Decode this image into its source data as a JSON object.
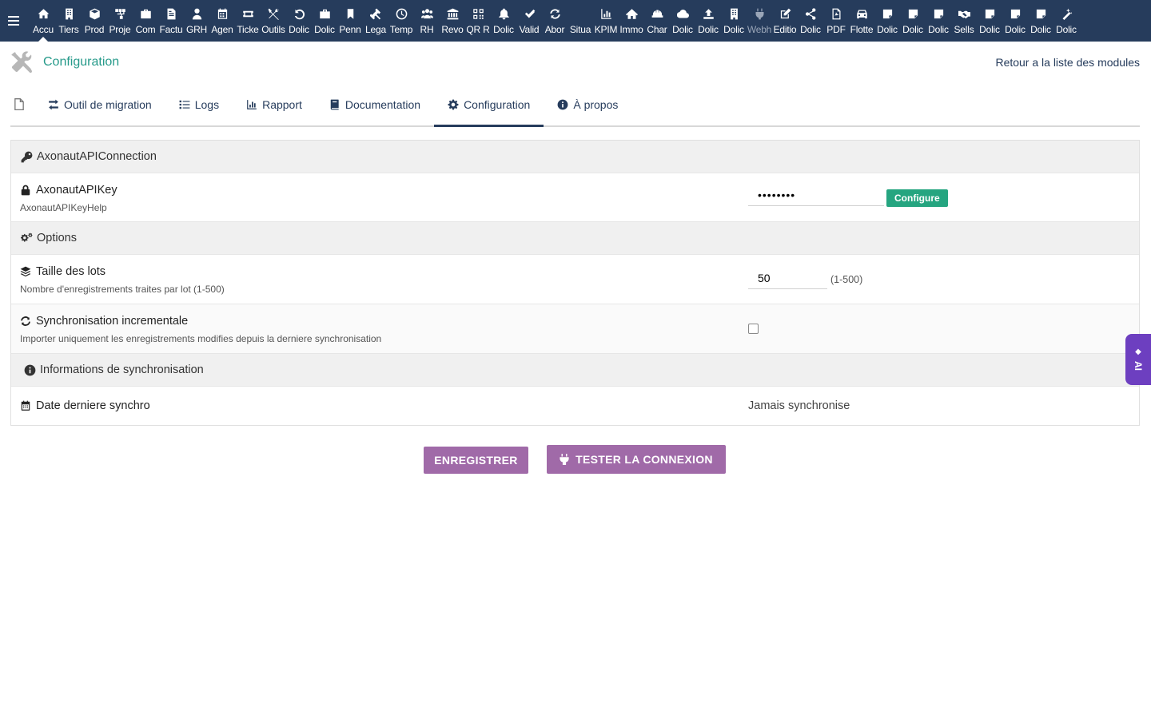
{
  "topbar": {
    "menu": [
      {
        "label": "Accu",
        "icon": "home-icon",
        "active": true
      },
      {
        "label": "Tiers",
        "icon": "building-icon"
      },
      {
        "label": "Prod",
        "icon": "cube-icon"
      },
      {
        "label": "Proje",
        "icon": "sitemap-icon"
      },
      {
        "label": "Com",
        "icon": "briefcase-icon"
      },
      {
        "label": "Factu",
        "icon": "file-invoice-icon"
      },
      {
        "label": "GRH",
        "icon": "user-tie-icon"
      },
      {
        "label": "Agen",
        "icon": "calendar-icon"
      },
      {
        "label": "Ticke",
        "icon": "ticket-icon"
      },
      {
        "label": "Outils",
        "icon": "tools-icon"
      },
      {
        "label": "Dolic",
        "icon": "undo-icon"
      },
      {
        "label": "Dolic",
        "icon": "toolbox-icon"
      },
      {
        "label": "Penn",
        "icon": "bookmark-icon"
      },
      {
        "label": "Lega",
        "icon": "gavel-icon"
      },
      {
        "label": "Temp",
        "icon": "clock-icon"
      },
      {
        "label": "RH",
        "icon": "users-icon"
      },
      {
        "label": "Revo",
        "icon": "bank-icon"
      },
      {
        "label": "QR R",
        "icon": "qrcode-icon"
      },
      {
        "label": "Dolic",
        "icon": "bell-icon"
      },
      {
        "label": "Valid",
        "icon": "double-check-icon"
      },
      {
        "label": "Abor",
        "icon": "sync-icon"
      },
      {
        "label": "Situa",
        "icon": "blank-icon"
      },
      {
        "label": "KPIM",
        "icon": "chart-bar-icon"
      },
      {
        "label": "Immo",
        "icon": "house-icon"
      },
      {
        "label": "Char",
        "icon": "hard-hat-icon"
      },
      {
        "label": "Dolic",
        "icon": "cloud-icon"
      },
      {
        "label": "Dolic",
        "icon": "upload-icon"
      },
      {
        "label": "Dolic",
        "icon": "building-icon"
      },
      {
        "label": "Webh",
        "icon": "plug-icon",
        "dim": true
      },
      {
        "label": "Editio",
        "icon": "edit-icon"
      },
      {
        "label": "Dolic",
        "icon": "share-icon"
      },
      {
        "label": "PDF",
        "icon": "file-pdf-icon"
      },
      {
        "label": "Flotte",
        "icon": "car-icon"
      },
      {
        "label": "Dolic",
        "icon": "note-icon"
      },
      {
        "label": "Dolic",
        "icon": "note-icon"
      },
      {
        "label": "Dolic",
        "icon": "note-icon"
      },
      {
        "label": "Sells",
        "icon": "handshake-icon"
      },
      {
        "label": "Dolic",
        "icon": "note-icon"
      },
      {
        "label": "Dolic",
        "icon": "note-icon"
      },
      {
        "label": "Dolic",
        "icon": "note-icon"
      },
      {
        "label": "Dolic",
        "icon": "magic-icon"
      }
    ]
  },
  "header": {
    "title": "Configuration",
    "back_link": "Retour a la liste des modules"
  },
  "tabs": [
    {
      "label": "",
      "icon": "file-icon"
    },
    {
      "label": "Outil de migration",
      "icon": "exchange-icon"
    },
    {
      "label": "Logs",
      "icon": "list-icon"
    },
    {
      "label": "Rapport",
      "icon": "chart-bar-icon"
    },
    {
      "label": "Documentation",
      "icon": "book-icon"
    },
    {
      "label": "Configuration",
      "icon": "gear-icon",
      "active": true
    },
    {
      "label": "À propos",
      "icon": "info-circle-icon"
    }
  ],
  "sections": {
    "connection": {
      "title": "AxonautAPIConnection",
      "api_key": {
        "label": "AxonautAPIKey",
        "help": "AxonautAPIKeyHelp",
        "value": "••••••••",
        "configure_label": "Configure"
      }
    },
    "options": {
      "title": "Options",
      "batch_size": {
        "label": "Taille des lots",
        "help": "Nombre d'enregistrements traites par lot (1-500)",
        "value": "50",
        "range": "(1-500)"
      },
      "incremental": {
        "label": "Synchronisation incrementale",
        "help": "Importer uniquement les enregistrements modifies depuis la derniere synchronisation",
        "checked": false
      }
    },
    "sync_info": {
      "title": "Informations de synchronisation",
      "last_sync": {
        "label": "Date derniere synchro",
        "value": "Jamais synchronise"
      }
    }
  },
  "actions": {
    "save_label": "Enregistrer",
    "test_label": "Tester la connexion"
  },
  "ai_tab": {
    "label": "AI"
  },
  "colors": {
    "topbar": "#263c5c",
    "title": "#269a8a",
    "configure_button": "#25a580",
    "action_button": "#a06aa8",
    "ai_tab": "#6d3fc0"
  }
}
